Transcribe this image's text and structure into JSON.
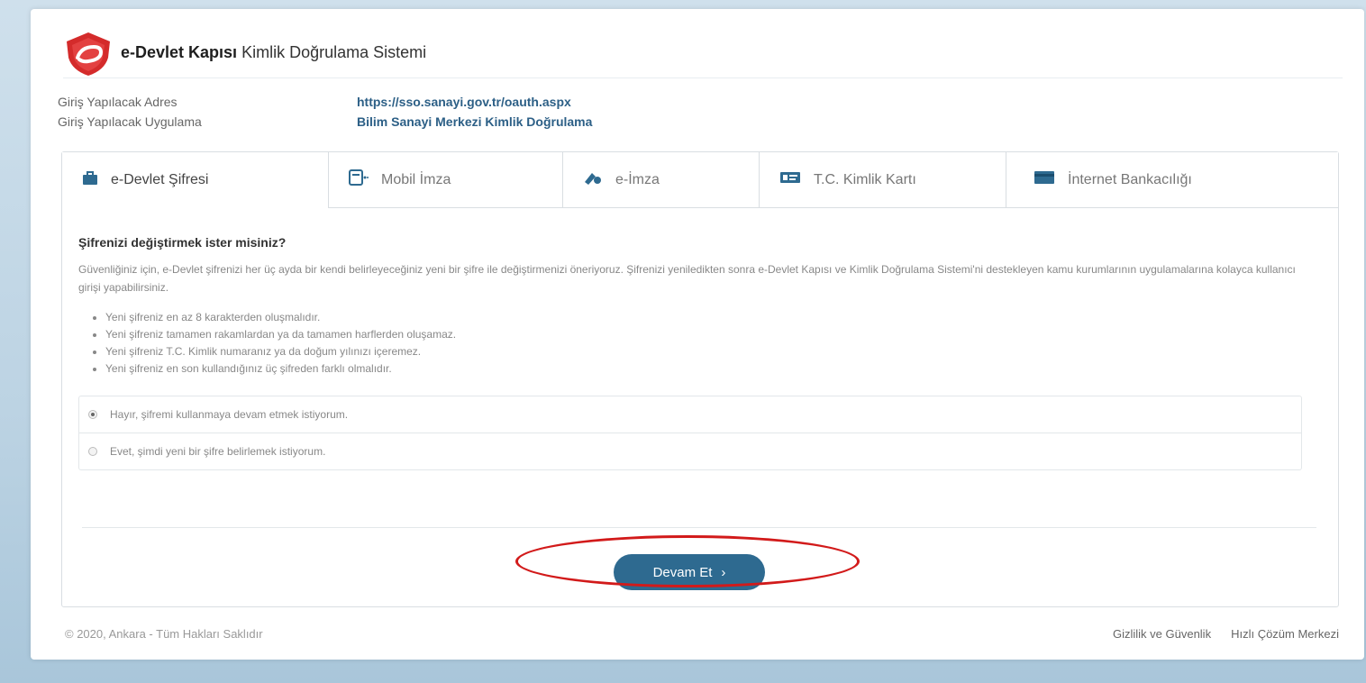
{
  "header": {
    "brand_bold": "e-Devlet Kapısı",
    "brand_rest": "Kimlik Doğrulama Sistemi"
  },
  "info": [
    {
      "label": "Giriş Yapılacak Adres",
      "value": "https://sso.sanayi.gov.tr/oauth.aspx"
    },
    {
      "label": "Giriş Yapılacak Uygulama",
      "value": "Bilim Sanayi Merkezi Kimlik Doğrulama"
    }
  ],
  "tabs": [
    {
      "label": "e-Devlet Şifresi",
      "icon": "briefcase-icon"
    },
    {
      "label": "Mobil İmza",
      "icon": "mobile-signature-icon"
    },
    {
      "label": "e-İmza",
      "icon": "usb-token-icon"
    },
    {
      "label": "T.C. Kimlik Kartı",
      "icon": "id-card-icon"
    },
    {
      "label": "İnternet Bankacılığı",
      "icon": "bank-card-icon"
    }
  ],
  "content": {
    "question": "Şifrenizi değiştirmek ister misiniz?",
    "description": "Güvenliğiniz için, e-Devlet şifrenizi her üç ayda bir kendi belirleyeceğiniz yeni bir şifre ile değiştirmenizi öneriyoruz. Şifrenizi yeniledikten sonra e-Devlet Kapısı ve Kimlik Doğrulama Sistemi'ni destekleyen kamu kurumlarının uygulamalarına kolayca kullanıcı girişi yapabilirsiniz.",
    "rules": [
      "Yeni şifreniz en az 8 karakterden oluşmalıdır.",
      "Yeni şifreniz tamamen rakamlardan ya da tamamen harflerden oluşamaz.",
      "Yeni şifreniz T.C. Kimlik numaranız ya da doğum yılınızı içeremez.",
      "Yeni şifreniz en son kullandığınız üç şifreden farklı olmalıdır."
    ],
    "options": [
      {
        "label": "Hayır, şifremi kullanmaya devam etmek istiyorum.",
        "selected": true
      },
      {
        "label": "Evet, şimdi yeni bir şifre belirlemek istiyorum.",
        "selected": false
      }
    ],
    "continue_label": "Devam Et"
  },
  "footer": {
    "copyright": "© 2020, Ankara - Tüm Hakları Saklıdır",
    "links": [
      "Gizlilik ve Güvenlik",
      "Hızlı Çözüm Merkezi"
    ]
  },
  "colors": {
    "accent": "#2e6a90",
    "highlight": "#d21a1a"
  }
}
